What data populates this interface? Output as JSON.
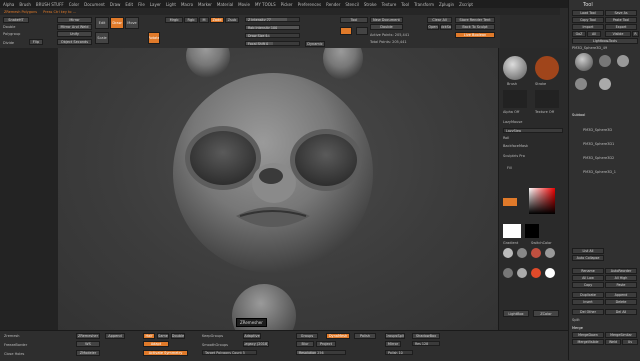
{
  "menu": [
    "Alpha",
    "Brush",
    "BRUSH STUFF",
    "Color",
    "Document",
    "Draw",
    "Edit",
    "File",
    "Layer",
    "Light",
    "Macro",
    "Marker",
    "Material",
    "Movie",
    "MY TOOLS",
    "Picker",
    "Preferences",
    "Render",
    "Stencil",
    "Stroke",
    "Texture",
    "Tool",
    "Transform",
    "Zplugin",
    "Zscript"
  ],
  "subbar": [
    "ZRemesh Polygons",
    "Press Ctrl key to ..."
  ],
  "shelf": {
    "brush_label": "SnakeHT",
    "mirror_label": "Mirror",
    "mirror_weld_label": "Mirror And Weld",
    "unify_label": "Unify",
    "double_label": "Double",
    "polygroup_label": "Polygroup",
    "front_label": "Front",
    "object_seconds_label": "Object Seconds",
    "divide_label": "Divide",
    "flip_label": "Flip",
    "move_label": "Move",
    "scale_label": "Scale",
    "rotate_label": "Rotate",
    "edit_label": "Edit",
    "draw_label": "Draw",
    "rgb_label": "Rgb",
    "mrgb_label": "Mrgb",
    "m_label": "M",
    "zadd_label": "Zadd",
    "zsub_label": "Zsub",
    "z_intensity": "Z Intensity 77",
    "rgb_intensity": "Rgb Intensity 100",
    "draw_size": "Draw Size 64",
    "focal_shift": "Focal Shift 0",
    "dynamic_label": "Dynamic",
    "new_document": "New Document",
    "double_btn": "Double",
    "active_points": "Active Points: 205,441",
    "total_points": "Total Points: 205,441",
    "tool_label": "Tool",
    "quick_save": "QuickSave",
    "clear_all": "Clear All",
    "open_label": "Open",
    "store_render": "Store Render Tent",
    "back_to_sculpt": "Back To Sculpt",
    "live_boolean": "Live Boolean"
  },
  "tool": {
    "title": "Tool",
    "load": "Load Tool",
    "save_as": "Save As",
    "copy": "Copy Tool",
    "paste": "Paste Tool",
    "import": "Import",
    "export": "Export",
    "goz": "GoZ",
    "all": "All",
    "visible": "Visible",
    "r": "R",
    "lightbox": "Lightbox▸Tools",
    "current": "PM3D_Sphere3D_49",
    "r2": "R",
    "subtool": "Subtool",
    "subtools": [
      "PM3D_Sphere3D",
      "PM3D_Sphere3D1",
      "PM3D_Sphere3D2",
      "PM3D_Sphere3D_1"
    ],
    "list_all": "List All",
    "auto_collapse": "Auto Collapse",
    "rename": "Rename",
    "auto_reorder": "AutoReorder",
    "all_low": "All Low",
    "all_high": "All High",
    "copy2": "Copy",
    "paste2": "Paste",
    "duplicate": "Duplicate",
    "append": "Append",
    "insert": "Insert",
    "delete": "Delete",
    "del_other": "Del Other",
    "del_all": "Del All",
    "split": "Split",
    "merge": "Merge",
    "merge_down": "MergeDown",
    "merge_similar": "MergeSimilar",
    "merge_visible": "MergeVisible",
    "weld": "Weld",
    "uv": "Uv"
  },
  "right_tray": {
    "brush": "Brush",
    "stroke": "Stroke",
    "alpha_off": "Alpha Off",
    "texture_off": "Texture Off",
    "lazy_mouse": "LazyMouse",
    "lazy_step": "LazyStep",
    "roll": "Roll",
    "backface": "BackfaceMask",
    "sculptris": "Sculptris Pro",
    "flat_color": "Flat Color",
    "fill": "Fill",
    "fill_object": "FillObject",
    "gradient": "Gradient",
    "swatch": "SwitchColor",
    "alternate": "Alternate",
    "matcaps": [
      "Basic Mat",
      "MatCap",
      "SkinShade4",
      "BasicMat",
      "Flat",
      "ZBrush_ZS",
      "ZBrush_ZS",
      "Polypaint"
    ],
    "lightbox": "LightBox",
    "zcolor": "ZColor"
  },
  "bottom": {
    "zremesh": "Zremesh",
    "zremesher": "ZRemesher",
    "freeze": "FreezeBorder",
    "keep_groups": "KeepGroups",
    "smooth_groups": "SmoothGroups",
    "adaptive": "Adaptive",
    "legacy": "Legacy (2018)",
    "half": "Half",
    "same": "Same",
    "double": "Double",
    "adapt": "Adapt",
    "target_polygons": "Target Polygons Count 5",
    "curves_strength": "Curves Strength 50",
    "use_polypaint": "Use Polypaint",
    "color_density": "Color Density",
    "append": "Append",
    "ws": "WS",
    "dynamesh": "DynaMesh",
    "groups": "Groups",
    "polish": "Polish",
    "blur": "Blur",
    "project": "Project",
    "resolution": "Resolution 256",
    "sub_projection": "Sub Projection 0.6",
    "group_split": "GroupsSplit",
    "shadow_box": "ShadowBox",
    "res": "Res 128",
    "mirror": "Mirror",
    "polish2": "Polish 10",
    "close_holes": "Close Holes",
    "zmodeler": "ZModeler",
    "qremesher": "QRemesher",
    "active_symmetry": "Activate Symmetry",
    "gizmo_label": "ZRemesher"
  },
  "colors": {
    "accent": "#e07a2a",
    "bg": "#2b2b2b",
    "panel": "#303030"
  }
}
